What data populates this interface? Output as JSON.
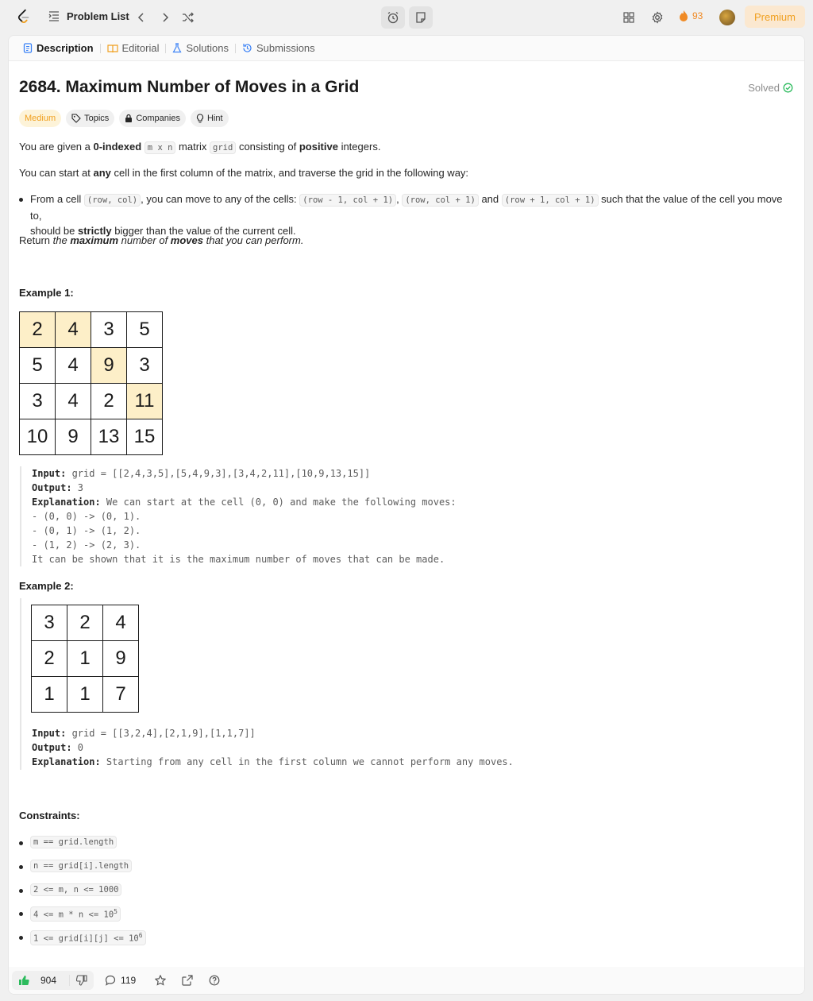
{
  "nav": {
    "problem_list": "Problem List",
    "streak_count": "93",
    "premium": "Premium"
  },
  "tabs": [
    {
      "label": "Description",
      "active": true
    },
    {
      "label": "Editorial"
    },
    {
      "label": "Solutions"
    },
    {
      "label": "Submissions"
    }
  ],
  "problem": {
    "title": "2684. Maximum Number of Moves in a Grid",
    "status": "Solved",
    "difficulty": "Medium",
    "chips": [
      "Topics",
      "Companies",
      "Hint"
    ]
  },
  "description": {
    "p1": {
      "a": "You are given a ",
      "b": "0-indexed",
      "c": "m x n",
      "d": " matrix ",
      "e": "grid",
      "f": " consisting of ",
      "g": "positive",
      "h": " integers."
    },
    "p2": {
      "a": "You can start at ",
      "b": "any",
      "c": " cell in the first column of the matrix, and traverse the grid in the following way:"
    },
    "bullet": {
      "a": "From a cell ",
      "b": "(row, col)",
      "c": ", you can move to any of the cells: ",
      "d": "(row - 1, col + 1)",
      "e": ", ",
      "f": "(row, col + 1)",
      "g": " and ",
      "h": "(row + 1, col + 1)",
      "i": " such that the value of the cell you move to,",
      "j": "should be ",
      "k": "strictly",
      "l": " bigger than the value of the current cell."
    },
    "p3": {
      "a": "Return ",
      "b": "the ",
      "c": "maximum",
      "d": " number of ",
      "e": "moves",
      "f": " that you can perform."
    }
  },
  "example1": {
    "heading": "Example 1:",
    "grid": [
      [
        2,
        4,
        3,
        5
      ],
      [
        5,
        4,
        9,
        3
      ],
      [
        3,
        4,
        2,
        11
      ],
      [
        10,
        9,
        13,
        15
      ]
    ],
    "input_label": "Input:",
    "input": " grid = [[2,4,3,5],[5,4,9,3],[3,4,2,11],[10,9,13,15]]",
    "output_label": "Output:",
    "output": " 3",
    "explanation_label": "Explanation:",
    "explanation": " We can start at the cell (0, 0) and make the following moves:\n- (0, 0) -> (0, 1).\n- (0, 1) -> (1, 2).\n- (1, 2) -> (2, 3).\nIt can be shown that it is the maximum number of moves that can be made."
  },
  "example2": {
    "heading": "Example 2:",
    "grid": [
      [
        3,
        2,
        4
      ],
      [
        2,
        1,
        9
      ],
      [
        1,
        1,
        7
      ]
    ],
    "input_label": "Input:",
    "input": " grid = [[3,2,4],[2,1,9],[1,1,7]]",
    "output_label": "Output:",
    "output": " 0",
    "explanation_label": "Explanation:",
    "explanation": " Starting from any cell in the first column we cannot perform any moves."
  },
  "constraints": {
    "heading": "Constraints:",
    "items": [
      {
        "text": "m == grid.length"
      },
      {
        "text": "n == grid[i].length"
      },
      {
        "text": "2 <= m, n <= 1000"
      },
      {
        "text": "4 <= m * n <= 10",
        "sup": "5"
      },
      {
        "text": "1 <= grid[i][j] <= 10",
        "sup": "6"
      }
    ]
  },
  "footer": {
    "likes": "904",
    "comments": "119"
  }
}
